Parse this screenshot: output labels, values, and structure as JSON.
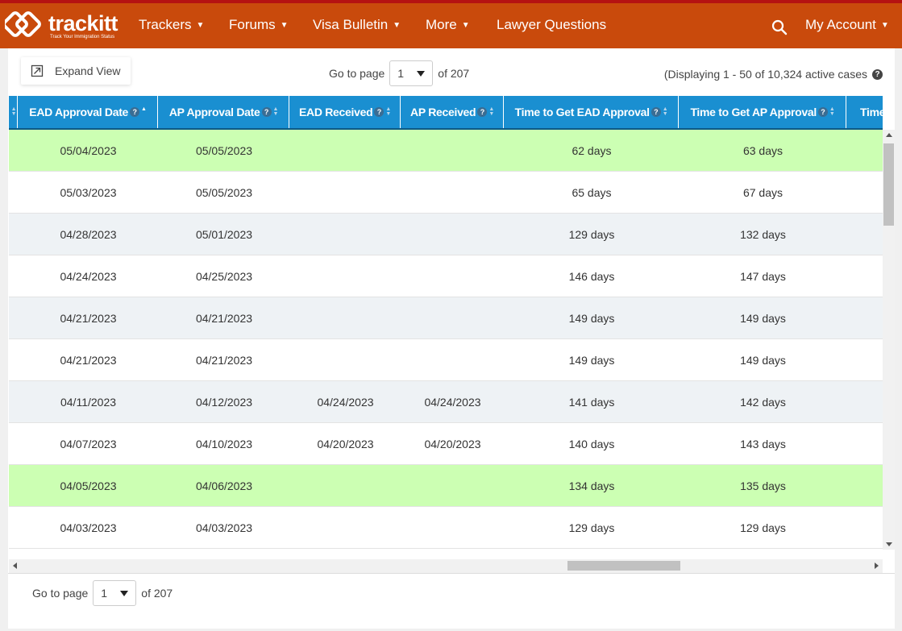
{
  "header": {
    "logo_name": "trackitt",
    "logo_tagline": "Track Your Immigration Status",
    "nav": [
      {
        "label": "Trackers",
        "dropdown": true
      },
      {
        "label": "Forums",
        "dropdown": true
      },
      {
        "label": "Visa Bulletin",
        "dropdown": true
      },
      {
        "label": "More",
        "dropdown": true
      },
      {
        "label": "Lawyer Questions",
        "dropdown": false
      }
    ],
    "account_label": "My Account",
    "search_icon": "search-icon",
    "colors": {
      "bar": "#c94a0c",
      "top_stripe": "#b51212"
    }
  },
  "toolbar": {
    "expand_label": "Expand View",
    "goto_label": "Go to page",
    "page_value": "1",
    "of_label": "of 207",
    "display_info": "(Displaying 1 - 50 of 10,324 active cases"
  },
  "table": {
    "header_color": "#1a8fd1",
    "highlight_color": "#ccffb3",
    "columns": [
      {
        "label": "",
        "help": false
      },
      {
        "label": "EAD Approval Date",
        "help": true,
        "sorted": "asc"
      },
      {
        "label": "AP Approval Date",
        "help": true
      },
      {
        "label": "EAD Received",
        "help": true
      },
      {
        "label": "AP Received",
        "help": true
      },
      {
        "label": "Time to Get EAD Approval",
        "help": true
      },
      {
        "label": "Time to Get AP Approval",
        "help": true
      },
      {
        "label": "Time",
        "help": false
      }
    ],
    "rows": [
      {
        "ead_approval": "05/04/2023",
        "ap_approval": "05/05/2023",
        "ead_received": "",
        "ap_received": "",
        "time_ead": "62 days",
        "time_ap": "63 days",
        "highlight": true
      },
      {
        "ead_approval": "05/03/2023",
        "ap_approval": "05/05/2023",
        "ead_received": "",
        "ap_received": "",
        "time_ead": "65 days",
        "time_ap": "67 days",
        "highlight": false
      },
      {
        "ead_approval": "04/28/2023",
        "ap_approval": "05/01/2023",
        "ead_received": "",
        "ap_received": "",
        "time_ead": "129 days",
        "time_ap": "132 days",
        "highlight": false
      },
      {
        "ead_approval": "04/24/2023",
        "ap_approval": "04/25/2023",
        "ead_received": "",
        "ap_received": "",
        "time_ead": "146 days",
        "time_ap": "147 days",
        "highlight": false
      },
      {
        "ead_approval": "04/21/2023",
        "ap_approval": "04/21/2023",
        "ead_received": "",
        "ap_received": "",
        "time_ead": "149 days",
        "time_ap": "149 days",
        "highlight": false
      },
      {
        "ead_approval": "04/21/2023",
        "ap_approval": "04/21/2023",
        "ead_received": "",
        "ap_received": "",
        "time_ead": "149 days",
        "time_ap": "149 days",
        "highlight": false
      },
      {
        "ead_approval": "04/11/2023",
        "ap_approval": "04/12/2023",
        "ead_received": "04/24/2023",
        "ap_received": "04/24/2023",
        "time_ead": "141 days",
        "time_ap": "142 days",
        "highlight": false
      },
      {
        "ead_approval": "04/07/2023",
        "ap_approval": "04/10/2023",
        "ead_received": "04/20/2023",
        "ap_received": "04/20/2023",
        "time_ead": "140 days",
        "time_ap": "143 days",
        "highlight": false
      },
      {
        "ead_approval": "04/05/2023",
        "ap_approval": "04/06/2023",
        "ead_received": "",
        "ap_received": "",
        "time_ead": "134 days",
        "time_ap": "135 days",
        "highlight": true
      },
      {
        "ead_approval": "04/03/2023",
        "ap_approval": "04/03/2023",
        "ead_received": "",
        "ap_received": "",
        "time_ead": "129 days",
        "time_ap": "129 days",
        "highlight": false
      }
    ]
  },
  "footer": {
    "goto_label": "Go to page",
    "page_value": "1",
    "of_label": "of 207"
  }
}
